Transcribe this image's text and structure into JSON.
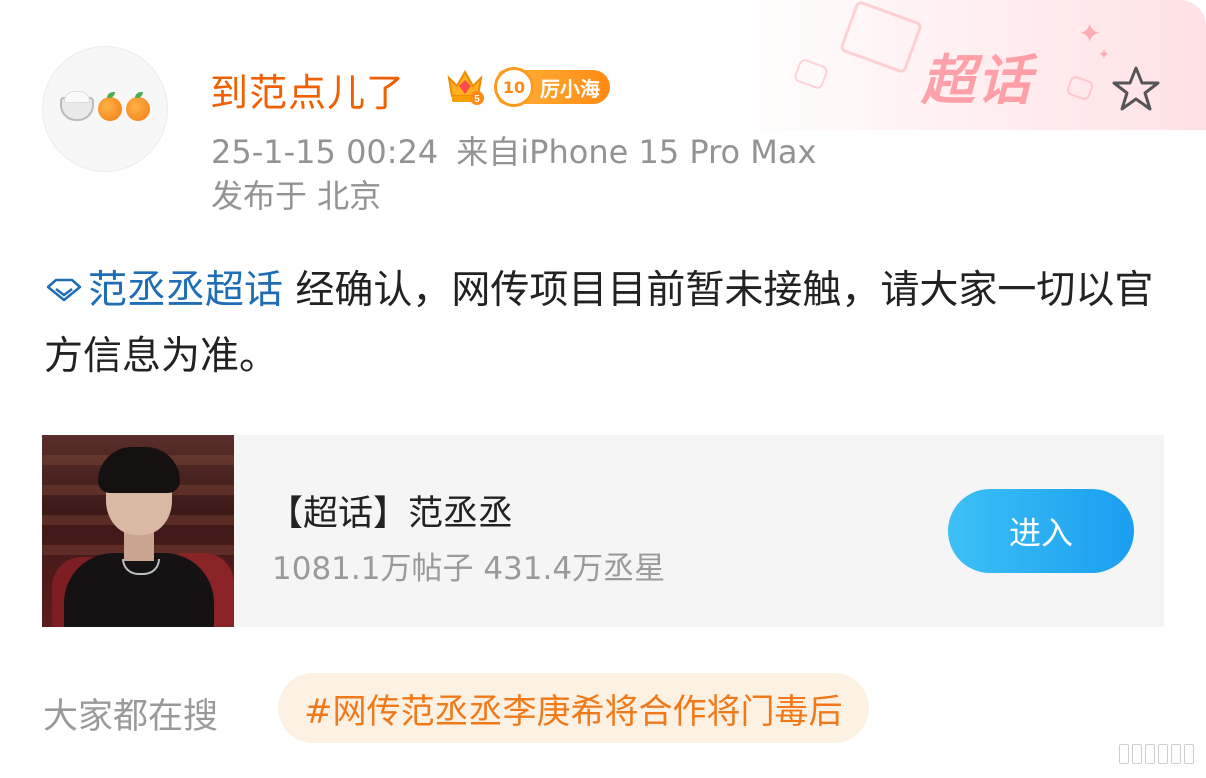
{
  "author": {
    "name": "到范点儿了",
    "avatar_icon": "rice-bowl-and-oranges-avatar",
    "crown_icon": "crown-level-icon",
    "fan_badge": {
      "level": "10",
      "label": "厉小海"
    }
  },
  "post_meta": {
    "time": "25-1-15 00:24",
    "source": "来自iPhone 15 Pro Max",
    "location": "发布于 北京"
  },
  "banner": {
    "label": "超话",
    "favorite_icon": "star-outline-icon"
  },
  "post": {
    "topic_link": "范丞丞超话",
    "topic_icon": "diamond-icon",
    "text": " 经确认，网传项目目前暂未接触，请大家一切以官方信息为准。"
  },
  "supertopic_card": {
    "title": "【超话】范丞丞",
    "stats": "1081.1万帖子 431.4万丞星",
    "enter_label": "进入"
  },
  "search": {
    "label": "大家都在搜",
    "hot_tag": "#网传范丞丞李庚希将合作将门毒后"
  },
  "colors": {
    "username": "#f06000",
    "link": "#1f6eb5",
    "enter_button": "#1a9ef0",
    "hot_tag_text": "#f07a1a",
    "hot_tag_bg": "#fdf1e3"
  }
}
